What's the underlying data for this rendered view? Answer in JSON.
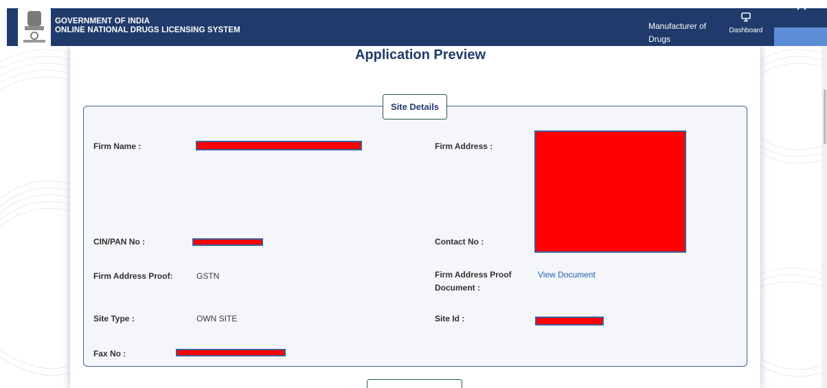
{
  "header": {
    "line1": "GOVERNMENT OF INDIA",
    "line2": "ONLINE NATIONAL DRUGS LICENSING SYSTEM",
    "role": "Manufacturer of Drugs",
    "dashboard_label": "Dashboard"
  },
  "page": {
    "title": "Application Preview"
  },
  "site_details": {
    "legend": "Site Details",
    "labels": {
      "firm_name": "Firm Name :",
      "firm_address": "Firm Address :",
      "cin_pan": "CIN/PAN No :",
      "contact_no": "Contact No :",
      "address_proof": "Firm Address Proof:",
      "address_proof_doc": "Firm Address Proof Document :",
      "site_type": "Site Type :",
      "site_id": "Site Id :",
      "fax_no": "Fax No :"
    },
    "values": {
      "address_proof": "GSTN",
      "address_proof_doc_link": "View Document",
      "site_type": "OWN SITE"
    }
  },
  "colors": {
    "header_bg": "#1f3a6b",
    "title": "#1f3a6b",
    "link": "#1d5fb0",
    "redaction": "#ff0000",
    "legend_border": "#2a5a42"
  }
}
